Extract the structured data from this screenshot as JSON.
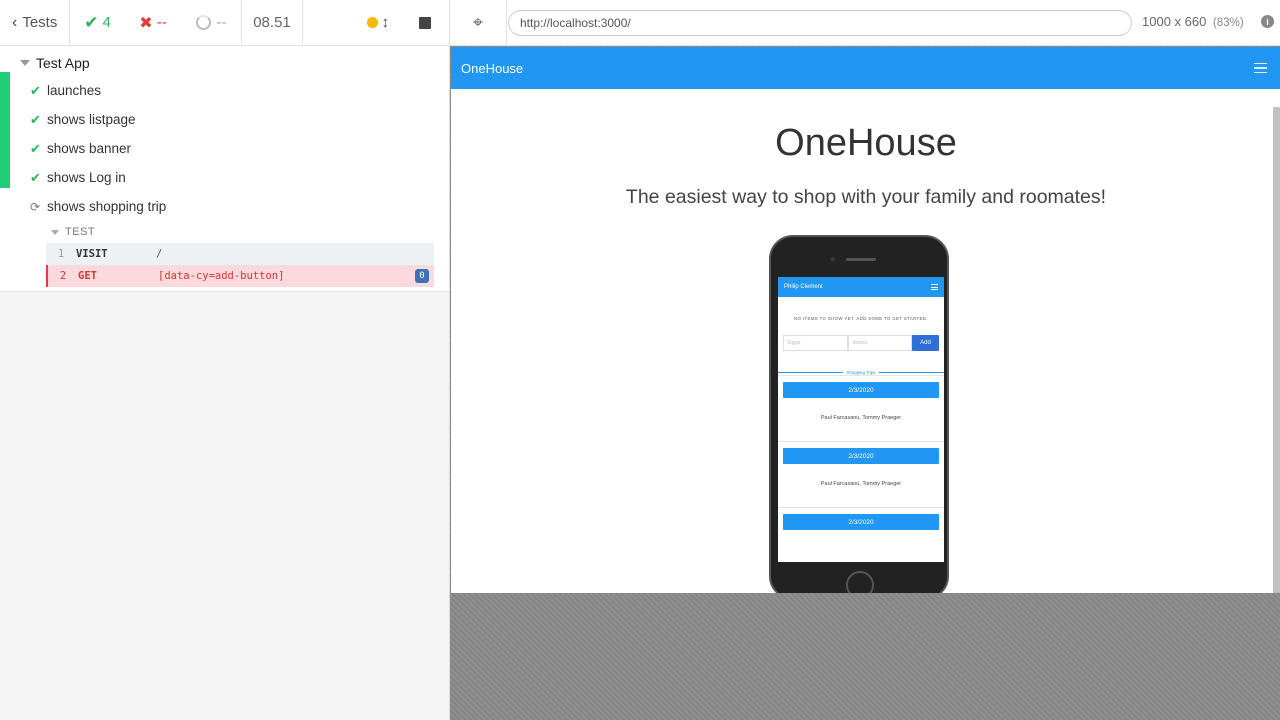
{
  "reporter": {
    "back_label": "Tests",
    "passed_count": "4",
    "failed_count": "--",
    "pending_count": "--",
    "duration": "08.51",
    "suite_title": "Test App",
    "tests": [
      {
        "title": "launches",
        "state": "passed"
      },
      {
        "title": "shows listpage",
        "state": "passed"
      },
      {
        "title": "shows banner",
        "state": "passed"
      },
      {
        "title": "shows Log in",
        "state": "passed"
      },
      {
        "title": "shows shopping trip",
        "state": "running"
      }
    ],
    "sub_suite_label": "TEST",
    "commands": [
      {
        "num": "1",
        "name": "VISIT",
        "message": "/"
      },
      {
        "num": "2",
        "name": "GET",
        "message": "[data-cy=add-button]",
        "badge": "0"
      }
    ],
    "colors": {
      "passed": "#1fcd77",
      "failed": "#e23b3b",
      "running": "#f5b800"
    }
  },
  "runner": {
    "url": "http://localhost:3000/",
    "viewport_size": "1000 x 660",
    "scale": "(83%)"
  },
  "app": {
    "brand": "OneHouse",
    "hero_title": "OneHouse",
    "hero_subtitle": "The easiest way to shop with your family and roomates!",
    "accent_color": "#2196f3",
    "phone": {
      "user_name": "Philip Clement",
      "empty_message": "NO ITEMS TO SHOW YET. ADD SOME TO GET STARTED.",
      "item_placeholder": "Eggs",
      "quantity_placeholder": "dozen",
      "add_label": "Add",
      "section_label": "Shopping Trips",
      "trips": [
        {
          "date": "2/3/2020",
          "people": "Paul Farcasanu, Tommy Praeger"
        },
        {
          "date": "2/3/2020",
          "people": "Paul Farcasanu, Tommy Praeger"
        },
        {
          "date": "2/3/2020",
          "people": ""
        }
      ]
    }
  }
}
